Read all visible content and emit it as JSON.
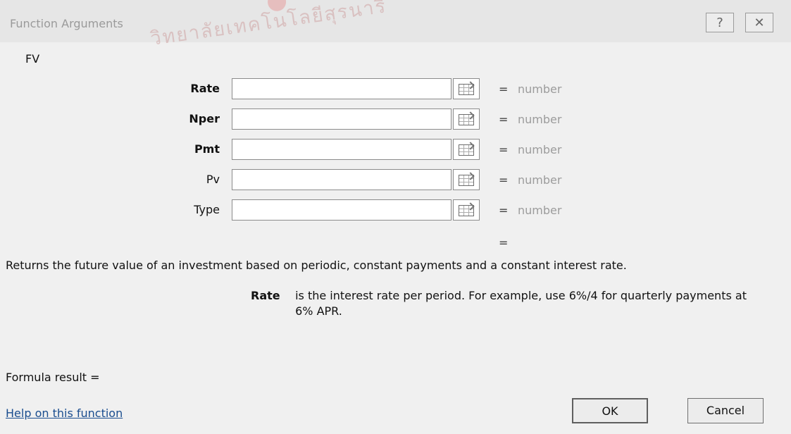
{
  "window": {
    "title": "Function Arguments",
    "help_label": "?",
    "close_label": "✕"
  },
  "watermark": "วิทยาลัยเทคโนโลยีสุรนารี",
  "function": {
    "name": "FV",
    "arguments": [
      {
        "label": "Rate",
        "value": "",
        "equals": "=",
        "result": "number"
      },
      {
        "label": "Nper",
        "value": "",
        "equals": "=",
        "result": "number"
      },
      {
        "label": "Pmt",
        "value": "",
        "equals": "=",
        "result": "number"
      },
      {
        "label": "Pv",
        "value": "",
        "equals": "=",
        "result": "number"
      },
      {
        "label": "Type",
        "value": "",
        "equals": "=",
        "result": "number"
      }
    ],
    "final_equals": "=",
    "description": "Returns the future value of an investment based on periodic, constant payments and a constant interest rate.",
    "argument_help": {
      "label": "Rate",
      "text": "is the interest rate per period. For example, use 6%/4 for quarterly payments at 6% APR."
    }
  },
  "footer": {
    "formula_result": "Formula result =",
    "help_link": "Help on this function",
    "ok": "OK",
    "cancel": "Cancel"
  },
  "icons": {
    "help": "help-question-icon",
    "close": "close-icon",
    "range_selector": "range-selector-icon"
  }
}
